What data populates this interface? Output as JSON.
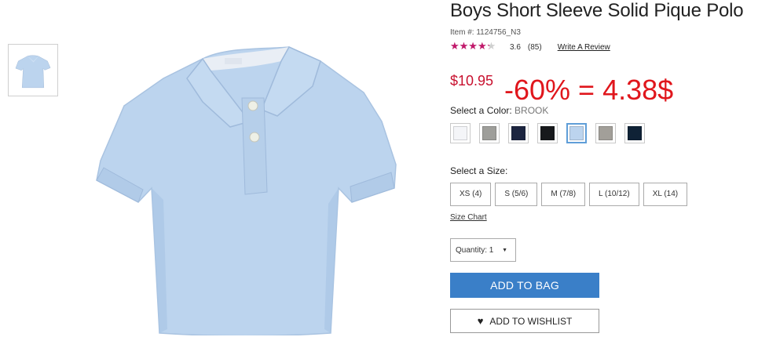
{
  "product": {
    "title": "Boys Short Sleeve Solid Pique Polo",
    "item_number": "Item #: 1124756_N3",
    "rating_value": "3.6",
    "rating_fraction": 0.72,
    "review_count": "(85)",
    "write_review": "Write A Review",
    "price": "$10.95",
    "promo_text": "-60% = 4.38$"
  },
  "color": {
    "label": "Select a Color:",
    "selected_name": "BROOK",
    "swatches": [
      {
        "name": "white",
        "hex": "#f4f5f8",
        "selected": false
      },
      {
        "name": "heather grey",
        "hex": "#9e9e9a",
        "selected": false
      },
      {
        "name": "navy",
        "hex": "#1c2540",
        "selected": false
      },
      {
        "name": "black",
        "hex": "#17191c",
        "selected": false
      },
      {
        "name": "brook",
        "hex": "#bcd4ee",
        "selected": true
      },
      {
        "name": "grey",
        "hex": "#a29f99",
        "selected": false
      },
      {
        "name": "dark navy",
        "hex": "#0f2236",
        "selected": false
      }
    ]
  },
  "size": {
    "label": "Select a Size:",
    "options": [
      "XS (4)",
      "S (5/6)",
      "M (7/8)",
      "L (10/12)",
      "XL (14)"
    ],
    "chart_link": "Size Chart"
  },
  "quantity": {
    "label": "Quantity: 1"
  },
  "actions": {
    "add_to_bag": "ADD TO BAG",
    "add_to_wishlist": "ADD TO WISHLIST"
  },
  "colors": {
    "promo": "#e0161c",
    "price": "#c8102e",
    "star": "#c2186b",
    "primary_button": "#3a7fc8",
    "shirt": "#bcd4ee"
  },
  "icons": {
    "wishlist": "heart-icon"
  }
}
